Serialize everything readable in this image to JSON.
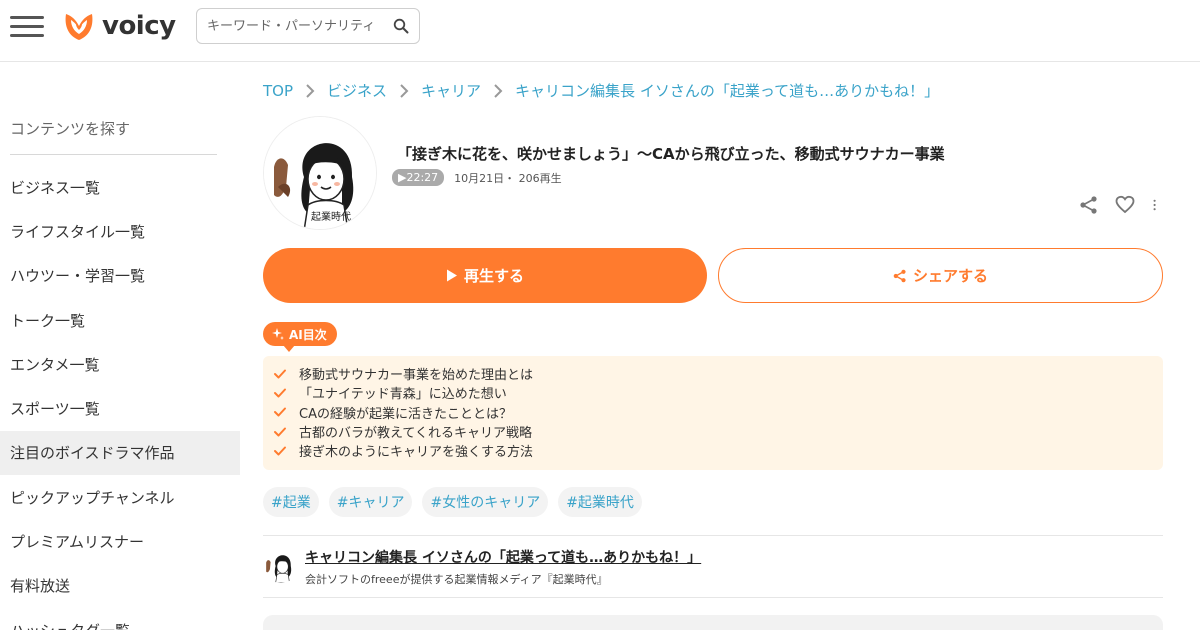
{
  "header": {
    "logo_text": "voicy",
    "search_placeholder": "キーワード・パーソナリティ",
    "brand_color": "#ff7b2e"
  },
  "sidebar": {
    "heading": "コンテンツを探す",
    "items": [
      {
        "label": "ビジネス一覧",
        "active": false
      },
      {
        "label": "ライフスタイル一覧",
        "active": false
      },
      {
        "label": "ハウツー・学習一覧",
        "active": false
      },
      {
        "label": "トーク一覧",
        "active": false
      },
      {
        "label": "エンタメ一覧",
        "active": false
      },
      {
        "label": "スポーツ一覧",
        "active": false
      },
      {
        "label": "注目のボイスドラマ作品",
        "active": true
      },
      {
        "label": "ピックアップチャンネル",
        "active": false
      },
      {
        "label": "プレミアムリスナー",
        "active": false
      },
      {
        "label": "有料放送",
        "active": false
      },
      {
        "label": "ハッシュタグ一覧",
        "active": false
      }
    ]
  },
  "breadcrumb": [
    "TOP",
    "ビジネス",
    "キャリア",
    "キャリコン編集長 イソさんの「起業って道も…ありかもね！」"
  ],
  "episode": {
    "title": "「接ぎ木に花を、咲かせましょう」〜CAから飛び立った、移動式サウナカー事業",
    "duration": "▶22:27",
    "date_plays": "10月21日・ 206再生",
    "avatar_caption": "起業時代"
  },
  "buttons": {
    "play_label": "再生する",
    "share_label": "シェアする"
  },
  "ai_toc": {
    "badge": "AI目次",
    "items": [
      "移動式サウナカー事業を始めた理由とは",
      "「ユナイテッド青森」に込めた想い",
      "CAの経験が起業に活きたこととは？",
      "古都のバラが教えてくれるキャリア戦略",
      "接ぎ木のようにキャリアを強くする方法"
    ]
  },
  "tags": [
    "#起業",
    "#キャリア",
    "#女性のキャリア",
    "#起業時代"
  ],
  "channel": {
    "name": "キャリコン編集長 イソさんの「起業って道も…ありかもね！」",
    "description": "会計ソフトのfreeeが提供する起業情報メディア『起業時代』"
  },
  "icons": [
    "menu-icon",
    "voicy-logo-icon",
    "search-icon",
    "chevron-right-icon",
    "share-icon",
    "heart-icon",
    "more-vertical-icon",
    "play-icon",
    "sparkle-icon",
    "check-icon"
  ]
}
